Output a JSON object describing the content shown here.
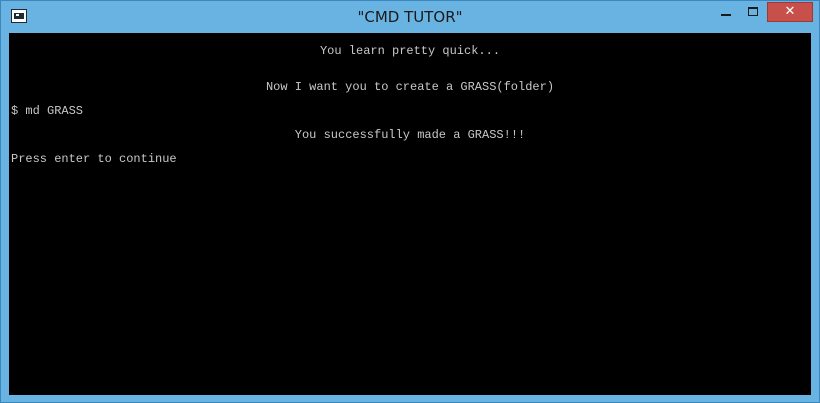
{
  "window": {
    "title": "\"CMD TUTOR\"",
    "close_glyph": "✕"
  },
  "console": {
    "lines": [
      "You learn pretty quick...",
      "Now I want you to create a GRASS(folder)",
      "$ md GRASS",
      "You successfully made a GRASS!!!",
      "Press enter to continue"
    ]
  },
  "colors": {
    "frame": "#69b3e3",
    "close_button": "#c7504b",
    "console_bg": "#000000",
    "console_text": "#c8c8c8"
  },
  "icons": {
    "app": "console-window-icon",
    "minimize": "minimize-icon",
    "maximize": "maximize-icon",
    "close": "close-icon"
  }
}
